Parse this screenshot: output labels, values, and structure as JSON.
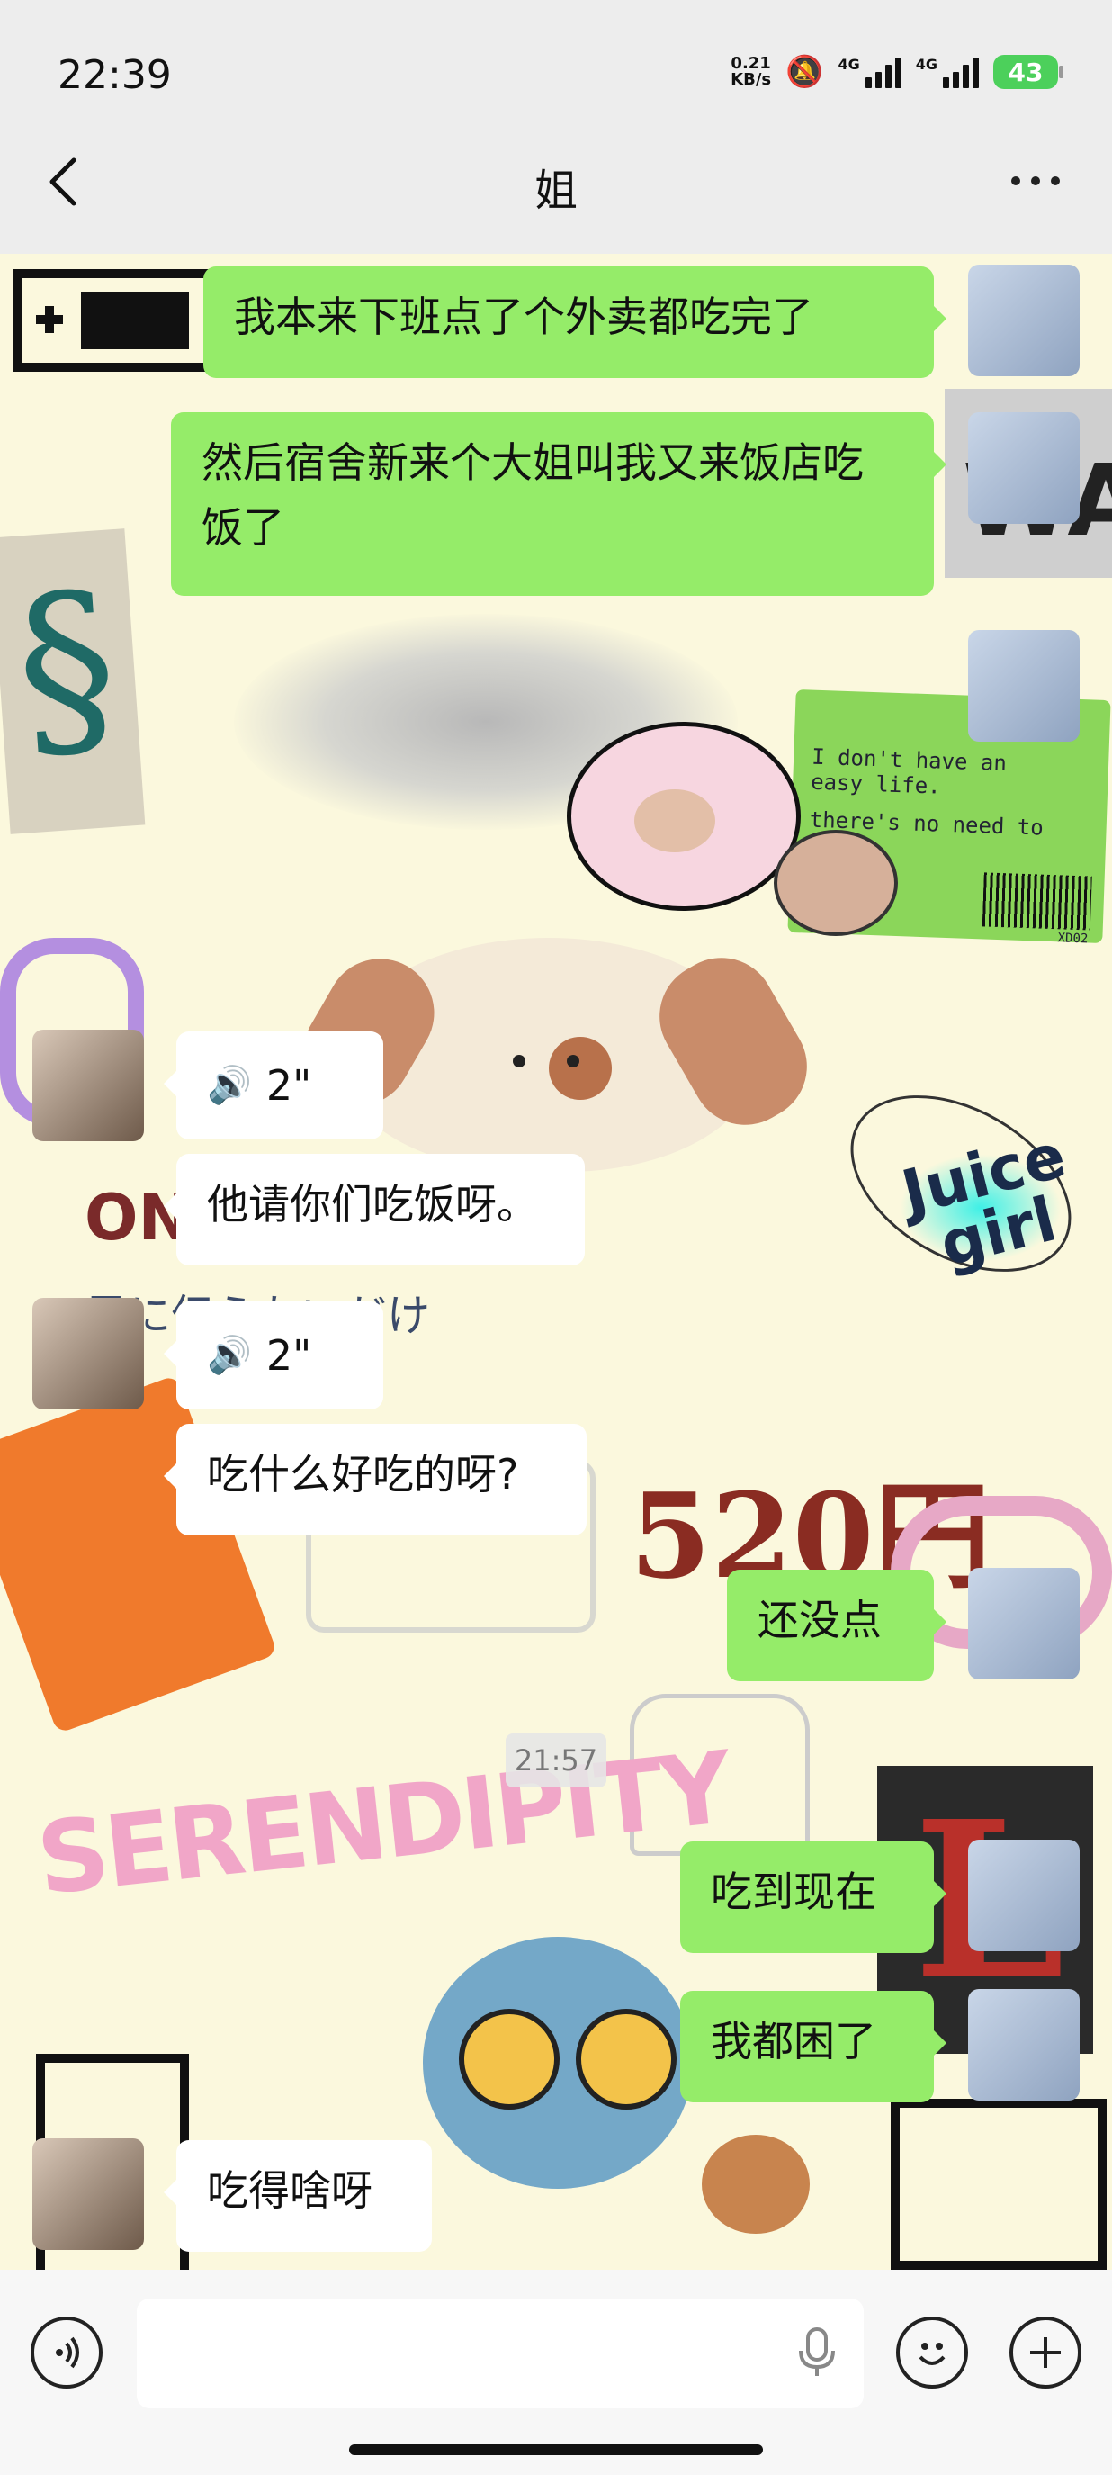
{
  "status": {
    "time": "22:39",
    "net_speed_value": "0.21",
    "net_speed_unit": "KB/s",
    "sig1_label": "4G",
    "sig2_label": "4G",
    "battery": "43"
  },
  "header": {
    "title": "姐"
  },
  "messages": [
    {
      "side": "me",
      "text": "我本来下班点了个外卖都吃完了"
    },
    {
      "side": "me",
      "text": "然后宿舍新来个大姐叫我又来饭店吃饭了"
    },
    {
      "side": "me",
      "type": "sticker"
    },
    {
      "side": "them",
      "type": "voice",
      "duration": "2\""
    },
    {
      "side": "them",
      "text": "他请你们吃饭呀。"
    },
    {
      "side": "them",
      "type": "voice",
      "duration": "2\""
    },
    {
      "side": "them",
      "text": "吃什么好吃的呀?"
    },
    {
      "side": "me",
      "text": "还没点"
    },
    {
      "side": "me",
      "text": "吃到现在"
    },
    {
      "side": "me",
      "text": "我都困了"
    },
    {
      "side": "them",
      "text": "吃得啥呀"
    }
  ],
  "timestamp": "21:57",
  "wallpaper_text": {
    "juice": "Juice",
    "girl": "girl",
    "yen": "520円",
    "serendipity": "SERENDIPITY",
    "sticker_line1": "I don't have an",
    "sticker_line2": "easy life.",
    "sticker_line3": "there's no need to",
    "sticker_code": "XD02",
    "only": "ONLY",
    "jp": "君に伝えたいだけ"
  },
  "colors": {
    "sent_bubble": "#95ec69",
    "received_bubble": "#ffffff",
    "chat_bg": "#fbf8dd",
    "bar_bg": "#ededed"
  }
}
